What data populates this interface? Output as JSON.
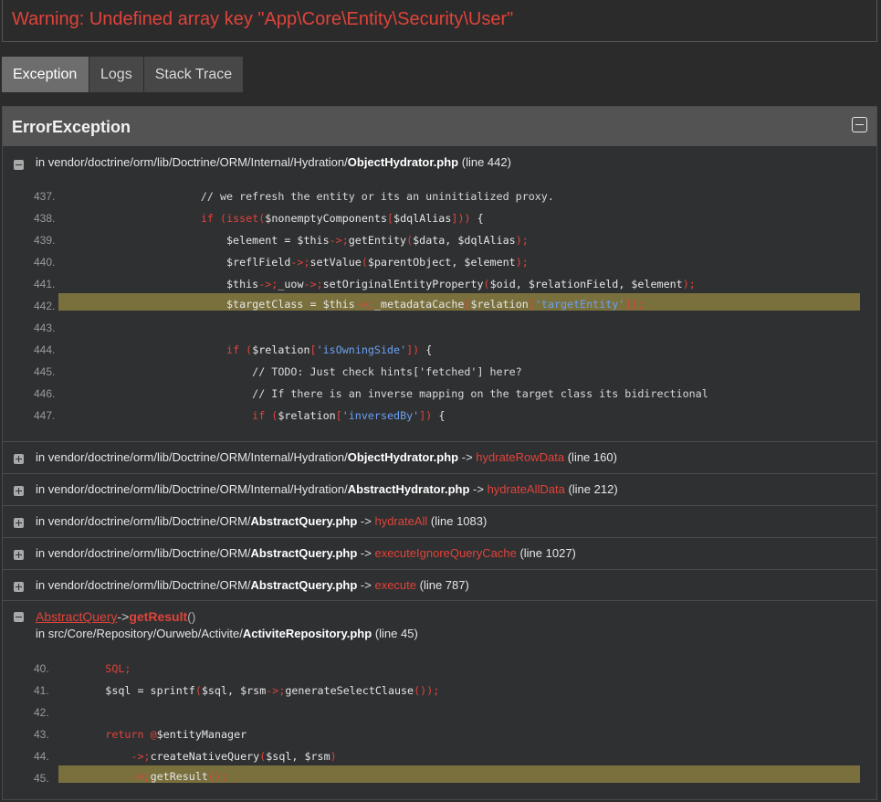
{
  "warning": {
    "title": "Warning: Undefined array key \"App\\Core\\Entity\\Security\\User\""
  },
  "tabs": [
    {
      "label": "Exception"
    },
    {
      "label": "Logs"
    },
    {
      "label": "Stack Trace"
    }
  ],
  "exception": {
    "title": "ErrorException"
  },
  "frame1": {
    "prefix": "in vendor/doctrine/orm/lib/Doctrine/ORM/Internal/Hydration/",
    "file": "ObjectHydrator.php",
    "line": "(line 442)",
    "code": [
      {
        "n": "437.",
        "t": "                        // we refresh the entity or its an uninitialized proxy."
      },
      {
        "n": "438.",
        "t": "                        if (isset($nonemptyComponents[$dqlAlias])) {"
      },
      {
        "n": "439.",
        "t": "                            $element = $this->getEntity($data, $dqlAlias);"
      },
      {
        "n": "440.",
        "t": "                            $reflField->setValue($parentObject, $element);"
      },
      {
        "n": "441.",
        "t": "                            $this->_uow->setOriginalEntityProperty($oid, $relationField, $element);"
      },
      {
        "n": "442.",
        "t": "                            $targetClass = $this->_metadataCache[$relation['targetEntity']];"
      },
      {
        "n": "443.",
        "t": ""
      },
      {
        "n": "444.",
        "t": "                            if ($relation['isOwningSide']) {"
      },
      {
        "n": "445.",
        "t": "                                // TODO: Just check hints['fetched'] here?"
      },
      {
        "n": "446.",
        "t": "                                // If there is an inverse mapping on the target class its bidirectional"
      },
      {
        "n": "447.",
        "t": "                                if ($relation['inversedBy']) {"
      }
    ]
  },
  "frames": [
    {
      "prefix": "in vendor/doctrine/orm/lib/Doctrine/ORM/Internal/Hydration/",
      "file": "ObjectHydrator.php",
      "arrow": "->",
      "fn": "hydrateRowData",
      "line": "(line 160)"
    },
    {
      "prefix": "in vendor/doctrine/orm/lib/Doctrine/ORM/Internal/Hydration/",
      "file": "AbstractHydrator.php",
      "arrow": "->",
      "fn": "hydrateAllData",
      "line": "(line 212)"
    },
    {
      "prefix": "in vendor/doctrine/orm/lib/Doctrine/ORM/",
      "file": "AbstractQuery.php",
      "arrow": "->",
      "fn": "hydrateAll",
      "line": "(line 1083)"
    },
    {
      "prefix": "in vendor/doctrine/orm/lib/Doctrine/ORM/",
      "file": "AbstractQuery.php",
      "arrow": "->",
      "fn": "executeIgnoreQueryCache",
      "line": "(line 1027)"
    },
    {
      "prefix": "in vendor/doctrine/orm/lib/Doctrine/ORM/",
      "file": "AbstractQuery.php",
      "arrow": "->",
      "fn": "execute",
      "line": "(line 787)"
    }
  ],
  "frame7": {
    "cls": "AbstractQuery",
    "arrow": "->",
    "method": "getResult",
    "paren": "()",
    "prefix": "in src/Core/Repository/Ourweb/Activite/",
    "file": "ActiviteRepository.php",
    "line": "(line 45)",
    "code": [
      {
        "n": "40.",
        "t": "        SQL;"
      },
      {
        "n": "41.",
        "t": "        $sql = sprintf($sql, $rsm->generateSelectClause());"
      },
      {
        "n": "42.",
        "t": ""
      },
      {
        "n": "43.",
        "t": "        return @$entityManager"
      },
      {
        "n": "44.",
        "t": "            ->createNativeQuery($sql, $rsm)"
      },
      {
        "n": "45.",
        "t": "            ->getResult();"
      }
    ]
  }
}
